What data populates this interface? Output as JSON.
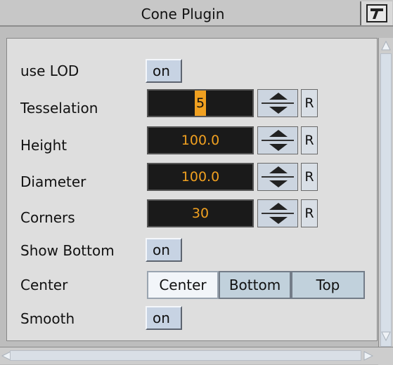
{
  "window": {
    "title": "Cone Plugin"
  },
  "fields": {
    "use_lod": {
      "label": "use LOD",
      "value": "on"
    },
    "tesselation": {
      "label": "Tesselation",
      "value": "5",
      "reset": "R"
    },
    "height": {
      "label": "Height",
      "value": "100.0",
      "reset": "R"
    },
    "diameter": {
      "label": "Diameter",
      "value": "100.0",
      "reset": "R"
    },
    "corners": {
      "label": "Corners",
      "value": "30",
      "reset": "R"
    },
    "show_bottom": {
      "label": "Show Bottom",
      "value": "on"
    },
    "center": {
      "label": "Center",
      "options": [
        "Center",
        "Bottom",
        "Top"
      ],
      "selected": "Center"
    },
    "smooth": {
      "label": "Smooth",
      "value": "on"
    }
  },
  "colors": {
    "numeric_bg": "#1a1a1a",
    "numeric_text": "#f0a020",
    "toggle_bg": "#c7d3e3"
  }
}
